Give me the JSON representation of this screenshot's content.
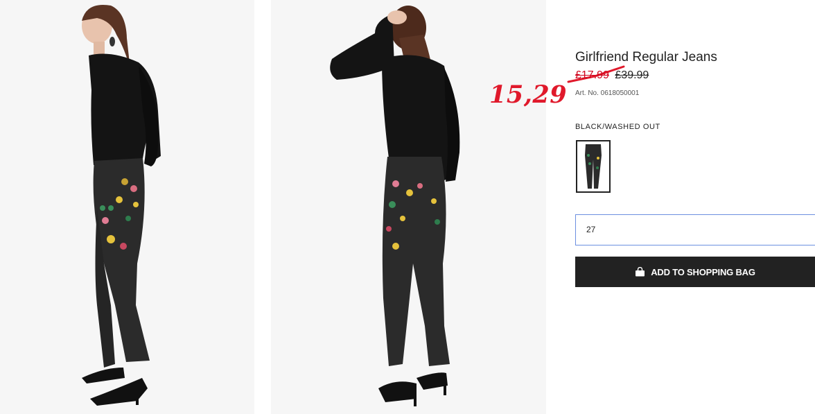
{
  "product": {
    "title": "Girlfriend Regular Jeans",
    "sale_price": "£17.99",
    "original_price": "£39.99",
    "article_number": "Art. No. 0618050001",
    "color_name": "BLACK/WASHED OUT"
  },
  "size_field": {
    "value": "27"
  },
  "add_button": {
    "label": "ADD TO SHOPPING BAG",
    "icon": "shopping-bag-icon"
  },
  "annotation": {
    "text": "15,29",
    "color": "#e0192b"
  },
  "colors": {
    "accent_red": "#d0021b",
    "button_bg": "#222222",
    "field_border": "#6b8fe0"
  }
}
